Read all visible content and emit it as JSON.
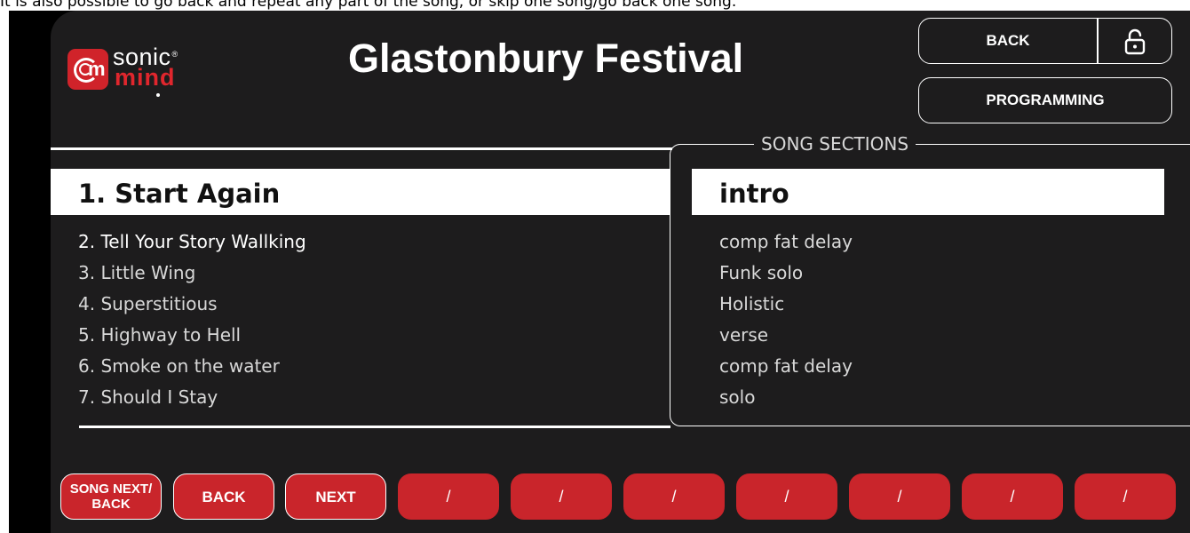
{
  "caption": "It is also possible to go back and repeat any part of the song, or skip one song/go back one song.",
  "logo": {
    "word_top": "sonic",
    "registered": "®",
    "word_bottom": "mind",
    "badge_letters": "m"
  },
  "header": {
    "title": "Glastonbury Festival"
  },
  "buttons": {
    "back": "BACK",
    "programming": "PROGRAMMING",
    "lock_icon": "unlocked-padlock-icon"
  },
  "setlist": {
    "current": "1. Start Again",
    "items": [
      "2. Tell Your Story Wallking",
      "3. Little Wing",
      "4. Superstitious",
      "5. Highway to Hell",
      "6. Smoke on the water",
      "7. Should I Stay"
    ]
  },
  "sections": {
    "legend": "SONG SECTIONS",
    "current": "intro",
    "items": [
      "comp fat delay",
      "Funk solo",
      "Holistic",
      "verse",
      "comp fat delay",
      "solo"
    ]
  },
  "footer": {
    "song_next_back": "SONG NEXT/ BACK",
    "back": "BACK",
    "next": "NEXT",
    "slots": [
      "/",
      "/",
      "/",
      "/",
      "/",
      "/",
      "/"
    ]
  },
  "colors": {
    "accent": "#c9252b",
    "screen_bg": "#1d1c1d",
    "highlight": "#ffffff"
  }
}
